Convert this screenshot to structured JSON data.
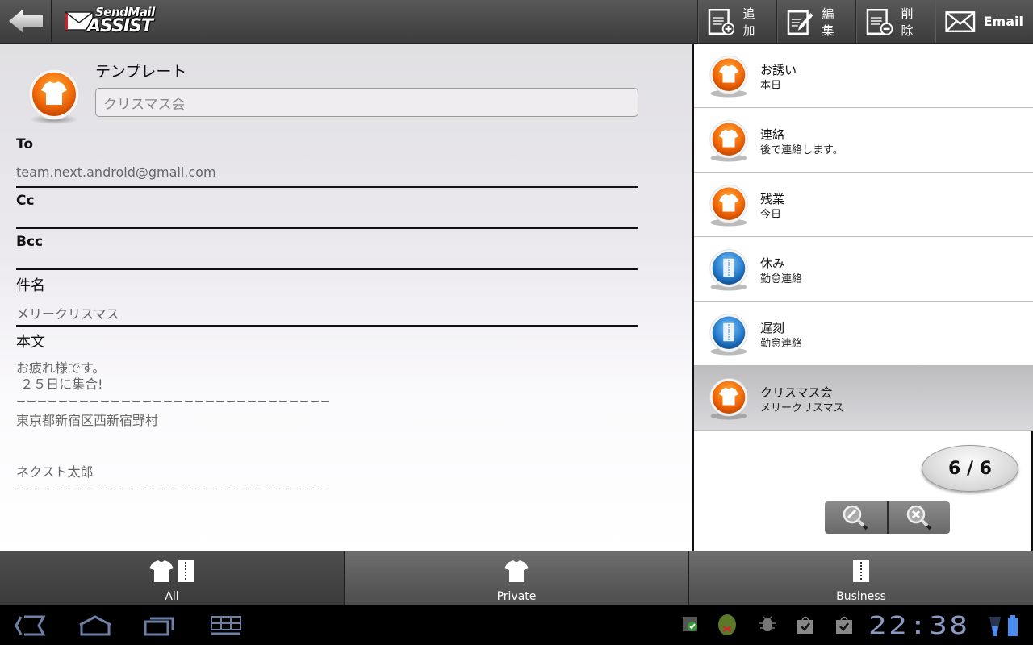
{
  "app": {
    "logo_line1": "SendMail",
    "logo_line2": "ASSIST"
  },
  "toolbar": {
    "back_icon": "back-arrow-icon",
    "actions": [
      {
        "label": "追加",
        "icon": "add-document-icon"
      },
      {
        "label": "編集",
        "icon": "edit-document-icon"
      },
      {
        "label": "削除",
        "icon": "delete-document-icon"
      },
      {
        "label": "Email",
        "icon": "envelope-icon"
      }
    ]
  },
  "form": {
    "template_label": "テンプレート",
    "template_value": "クリスマス会",
    "template_icon": "tshirt-orange-icon",
    "to_label": "To",
    "to_value": "team.next.android@gmail.com",
    "cc_label": "Cc",
    "cc_value": "",
    "bcc_label": "Bcc",
    "bcc_value": "",
    "subject_label": "件名",
    "subject_value": "メリークリスマス",
    "body_label": "本文",
    "body_lines": [
      "お疲れ様です。",
      " ２５日に集合!",
      "ーーーーーーーーーーーーーーーーーーーーーーーーーーーーーー",
      "東京都新宿区西新宿野村",
      "",
      "",
      "ネクスト太郎",
      "ーーーーーーーーーーーーーーーーーーーーーーーーーーーーーー"
    ]
  },
  "template_list": {
    "items": [
      {
        "title": "お誘い",
        "subtitle": "本日",
        "category": "private",
        "selected": false
      },
      {
        "title": "連絡",
        "subtitle": "後で連絡します。",
        "category": "private",
        "selected": false
      },
      {
        "title": "残業",
        "subtitle": "今日",
        "category": "private",
        "selected": false
      },
      {
        "title": "休み",
        "subtitle": "勤怠連絡",
        "category": "business",
        "selected": false
      },
      {
        "title": "遅刻",
        "subtitle": "勤怠連絡",
        "category": "business",
        "selected": false
      },
      {
        "title": "クリスマス会",
        "subtitle": "メリークリスマス",
        "category": "private",
        "selected": true
      }
    ],
    "pager": "6 / 6",
    "zoom_in_icon": "magnifier-zoom-in-icon",
    "zoom_reset_icon": "magnifier-close-icon"
  },
  "tabs": [
    {
      "label": "All",
      "active": true
    },
    {
      "label": "Private",
      "active": false
    },
    {
      "label": "Business",
      "active": false
    }
  ],
  "system_bar": {
    "time": "22:38",
    "colors": {
      "clock": "#8a98c2",
      "battery": "#4a8cf0"
    }
  },
  "colors": {
    "private_accent": "#f07a10",
    "business_accent": "#2a7fd0",
    "toolbar_bg": "#484848"
  }
}
